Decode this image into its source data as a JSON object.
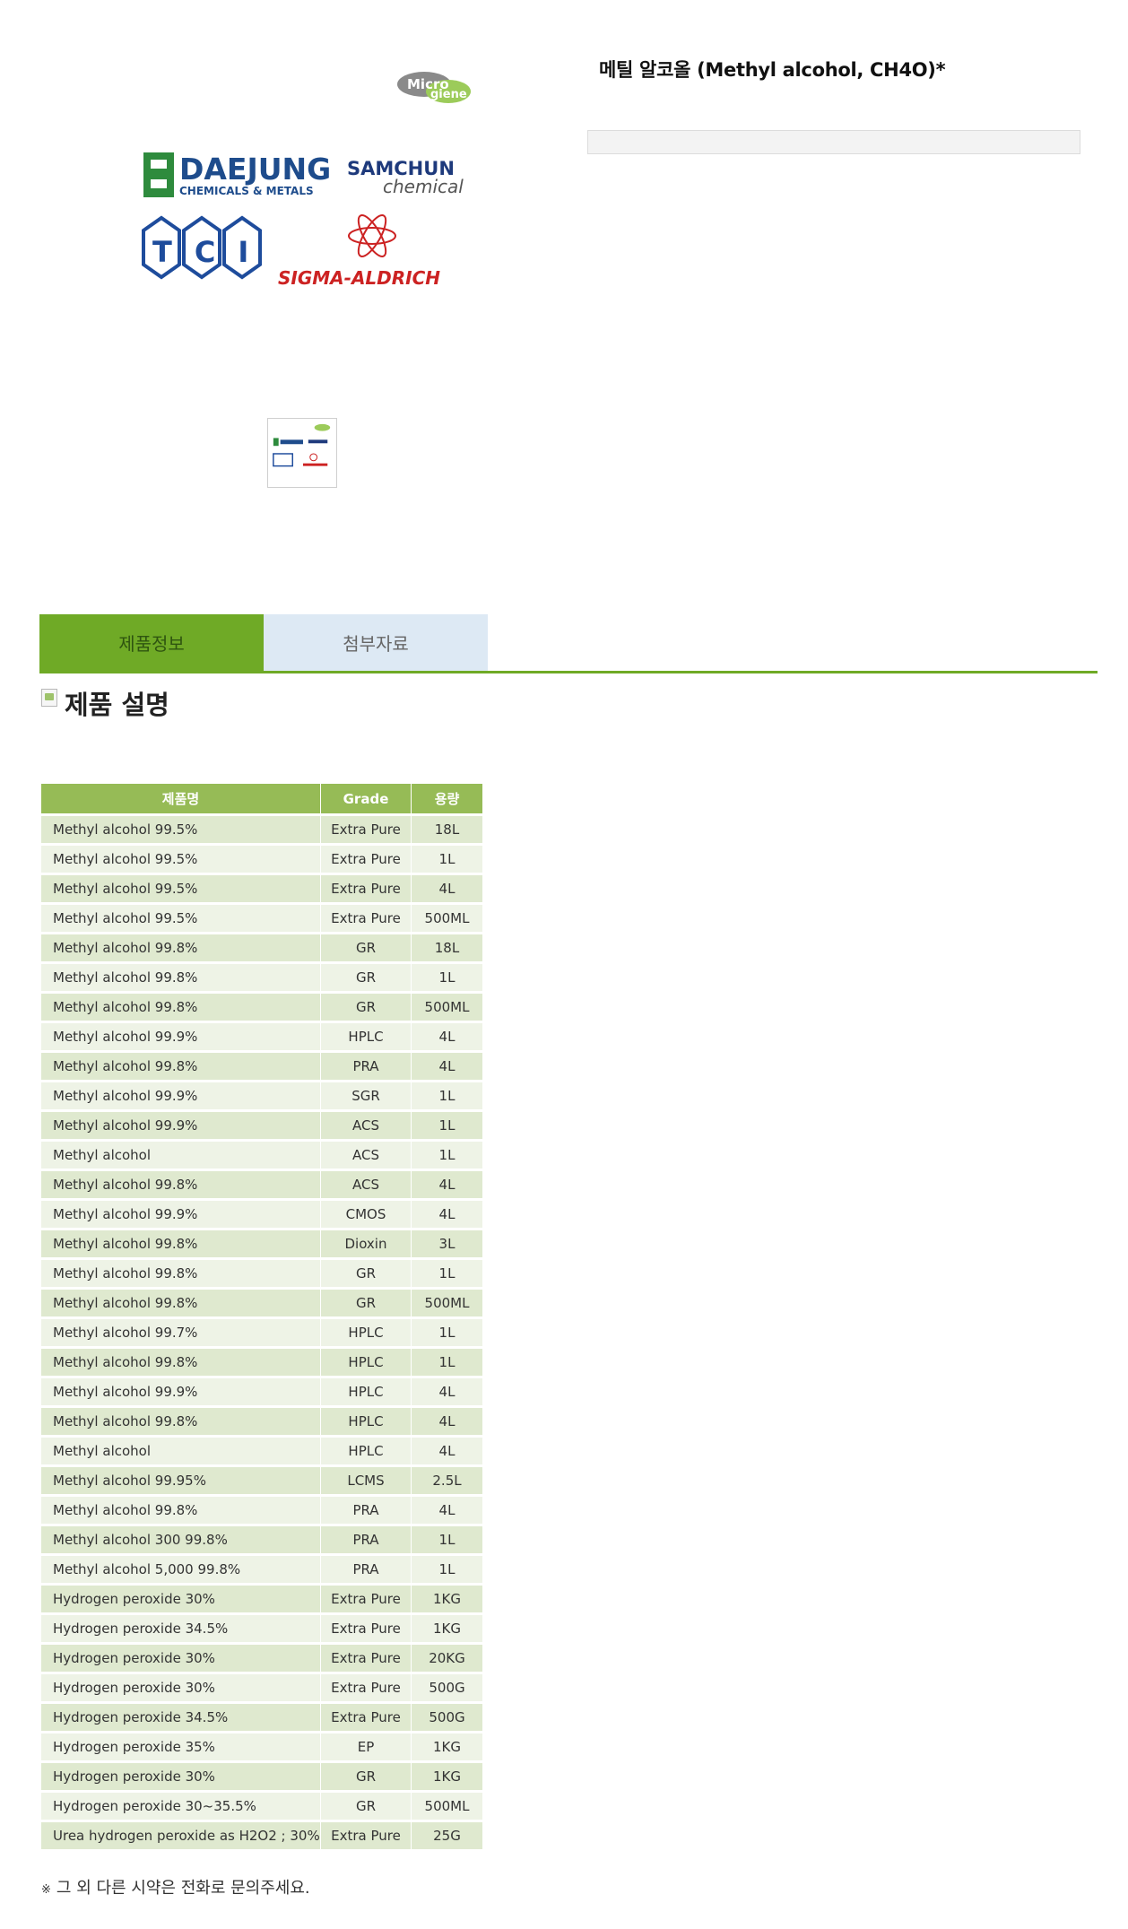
{
  "product": {
    "title": "메틸 알코올 (Methyl alcohol, CH4O)*"
  },
  "brand_logos": {
    "microgiene_text": "Micro",
    "microgiene_text2": "giene",
    "daejung_text": "DAEJUNG",
    "daejung_sub": "CHEMICALS & METALS",
    "samchun_text": "SAMCHUN",
    "samchun_sub": "chemical",
    "tci_text": "TCI",
    "sigma_text": "SIGMA-ALDRICH"
  },
  "tabs": [
    {
      "label": "제품정보",
      "active": true
    },
    {
      "label": "첨부자료",
      "active": false
    }
  ],
  "section_title": "제품 설명",
  "table": {
    "headers": [
      "제품명",
      "Grade",
      "용량"
    ],
    "rows": [
      [
        "Methyl alcohol 99.5%",
        "Extra Pure",
        "18L"
      ],
      [
        "Methyl alcohol 99.5%",
        "Extra Pure",
        "1L"
      ],
      [
        "Methyl alcohol 99.5%",
        "Extra Pure",
        "4L"
      ],
      [
        "Methyl alcohol 99.5%",
        "Extra Pure",
        "500ML"
      ],
      [
        "Methyl alcohol 99.8%",
        "GR",
        "18L"
      ],
      [
        "Methyl alcohol 99.8%",
        "GR",
        "1L"
      ],
      [
        "Methyl alcohol 99.8%",
        "GR",
        "500ML"
      ],
      [
        "Methyl alcohol 99.9%",
        "HPLC",
        "4L"
      ],
      [
        "Methyl alcohol 99.8%",
        "PRA",
        "4L"
      ],
      [
        "Methyl alcohol 99.9%",
        "SGR",
        "1L"
      ],
      [
        "Methyl alcohol 99.9%",
        "ACS",
        "1L"
      ],
      [
        "Methyl alcohol",
        "ACS",
        "1L"
      ],
      [
        "Methyl alcohol 99.8%",
        "ACS",
        "4L"
      ],
      [
        "Methyl alcohol 99.9%",
        "CMOS",
        "4L"
      ],
      [
        "Methyl alcohol 99.8%",
        "Dioxin",
        "3L"
      ],
      [
        "Methyl alcohol 99.8%",
        "GR",
        "1L"
      ],
      [
        "Methyl alcohol 99.8%",
        "GR",
        "500ML"
      ],
      [
        "Methyl alcohol 99.7%",
        "HPLC",
        "1L"
      ],
      [
        "Methyl alcohol 99.8%",
        "HPLC",
        "1L"
      ],
      [
        "Methyl alcohol 99.9%",
        "HPLC",
        "4L"
      ],
      [
        "Methyl alcohol 99.8%",
        "HPLC",
        "4L"
      ],
      [
        "Methyl alcohol",
        "HPLC",
        "4L"
      ],
      [
        "Methyl alcohol 99.95%",
        "LCMS",
        "2.5L"
      ],
      [
        "Methyl alcohol 99.8%",
        "PRA",
        "4L"
      ],
      [
        "Methyl alcohol 300 99.8%",
        "PRA",
        "1L"
      ],
      [
        "Methyl alcohol 5,000 99.8%",
        "PRA",
        "1L"
      ],
      [
        "Hydrogen peroxide 30%",
        "Extra Pure",
        "1KG"
      ],
      [
        "Hydrogen peroxide 34.5%",
        "Extra Pure",
        "1KG"
      ],
      [
        "Hydrogen peroxide 30%",
        "Extra Pure",
        "20KG"
      ],
      [
        "Hydrogen peroxide 30%",
        "Extra Pure",
        "500G"
      ],
      [
        "Hydrogen peroxide 34.5%",
        "Extra Pure",
        "500G"
      ],
      [
        "Hydrogen peroxide 35%",
        "EP",
        "1KG"
      ],
      [
        "Hydrogen peroxide 30%",
        "GR",
        "1KG"
      ],
      [
        "Hydrogen peroxide 30~35.5%",
        "GR",
        "500ML"
      ],
      [
        "Urea hydrogen peroxide as H2O2 ; 30%",
        "Extra Pure",
        "25G"
      ]
    ]
  },
  "footnote": {
    "mark": "※",
    "text": "그 외 다른 시약은 전화로 문의주세요."
  },
  "colors": {
    "tab_active": "#6faa26",
    "tab_inactive": "#dde9f4",
    "table_header": "#96bb56",
    "row_odd": "#dfe9cf",
    "row_even": "#eef3e6"
  }
}
